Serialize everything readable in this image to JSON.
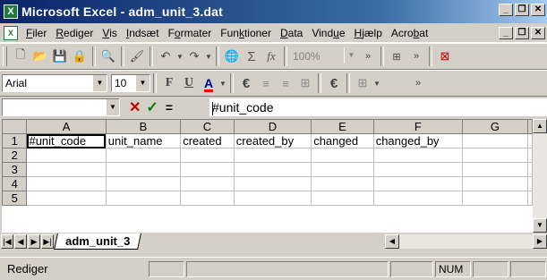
{
  "window": {
    "app_icon": "excel-icon",
    "title": "Microsoft Excel - adm_unit_3.dat",
    "controls": [
      "minimize",
      "restore",
      "close"
    ]
  },
  "menubar": {
    "doc_icon": "excel-doc-icon",
    "items": [
      {
        "pre": "",
        "u": "F",
        "post": "iler"
      },
      {
        "pre": "",
        "u": "R",
        "post": "ediger"
      },
      {
        "pre": "",
        "u": "V",
        "post": "is"
      },
      {
        "pre": "",
        "u": "I",
        "post": "ndsæt"
      },
      {
        "pre": "F",
        "u": "o",
        "post": "rmater"
      },
      {
        "pre": "Fun",
        "u": "k",
        "post": "tioner"
      },
      {
        "pre": "",
        "u": "D",
        "post": "ata"
      },
      {
        "pre": "Vind",
        "u": "u",
        "post": "e"
      },
      {
        "pre": "",
        "u": "H",
        "post": "jælp"
      },
      {
        "pre": "Acro",
        "u": "b",
        "post": "at"
      }
    ]
  },
  "toolbar_standard": {
    "zoom": "100%"
  },
  "toolbar_format": {
    "font_name": "Arial",
    "font_size": "10",
    "bold_label": "F",
    "underline_label": "U",
    "font_color_label": "A",
    "euro_label": "€"
  },
  "formula_bar": {
    "name_box": "",
    "cancel_label": "✕",
    "enter_label": "✓",
    "equals_label": "=",
    "content": "#unit_code"
  },
  "grid": {
    "columns": [
      "A",
      "B",
      "C",
      "D",
      "E",
      "F",
      "G"
    ],
    "rows": [
      {
        "num": "1",
        "cells": [
          "#unit_code",
          "unit_name",
          "created",
          "created_by",
          "changed",
          "changed_by",
          ""
        ]
      },
      {
        "num": "2",
        "cells": [
          "",
          "",
          "",
          "",
          "",
          "",
          ""
        ]
      },
      {
        "num": "3",
        "cells": [
          "",
          "",
          "",
          "",
          "",
          "",
          ""
        ]
      },
      {
        "num": "4",
        "cells": [
          "",
          "",
          "",
          "",
          "",
          "",
          ""
        ]
      },
      {
        "num": "5",
        "cells": [
          "",
          "",
          "",
          "",
          "",
          "",
          ""
        ]
      }
    ]
  },
  "sheets": {
    "tabs": [
      "adm_unit_3"
    ]
  },
  "statusbar": {
    "mode": "Rediger",
    "num": "NUM"
  }
}
